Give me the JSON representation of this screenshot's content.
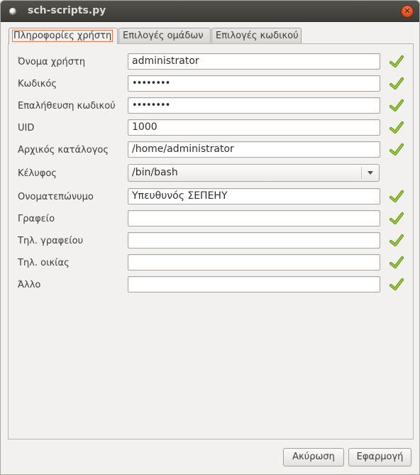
{
  "window": {
    "title": "sch-scripts.py"
  },
  "tabs": [
    {
      "label": "Πληροφορίες χρήστη",
      "active": true
    },
    {
      "label": "Επιλογές ομάδων",
      "active": false
    },
    {
      "label": "Επιλογές κωδικού",
      "active": false
    }
  ],
  "form": {
    "username": {
      "label": "Όνομα χρήστη",
      "value": "administrator",
      "valid": true
    },
    "password": {
      "label": "Κωδικός",
      "value": "••••••••",
      "valid": true
    },
    "password_confirm": {
      "label": "Επαλήθευση κωδικού",
      "value": "••••••••",
      "valid": true
    },
    "uid": {
      "label": "UID",
      "value": "1000",
      "valid": true
    },
    "home_dir": {
      "label": "Αρχικός κατάλογος",
      "value": "/home/administrator",
      "valid": true
    },
    "shell": {
      "label": "Κέλυφος",
      "value": "/bin/bash"
    },
    "full_name": {
      "label": "Ονοματεπώνυμο",
      "value": "Υπευθυνός ΣΕΠΕΗΥ",
      "valid": true
    },
    "office": {
      "label": "Γραφείο",
      "value": "",
      "valid": true
    },
    "office_phone": {
      "label": "Τηλ. γραφείου",
      "value": "",
      "valid": true
    },
    "home_phone": {
      "label": "Τηλ. οικίας",
      "value": "",
      "valid": true
    },
    "other": {
      "label": "Άλλο",
      "value": "",
      "valid": true
    }
  },
  "buttons": {
    "cancel": "Ακύρωση",
    "apply": "Εφαρμογή"
  },
  "colors": {
    "check": "#7fb01e",
    "titlebar": "#3c3b37",
    "focus": "#f07746"
  }
}
